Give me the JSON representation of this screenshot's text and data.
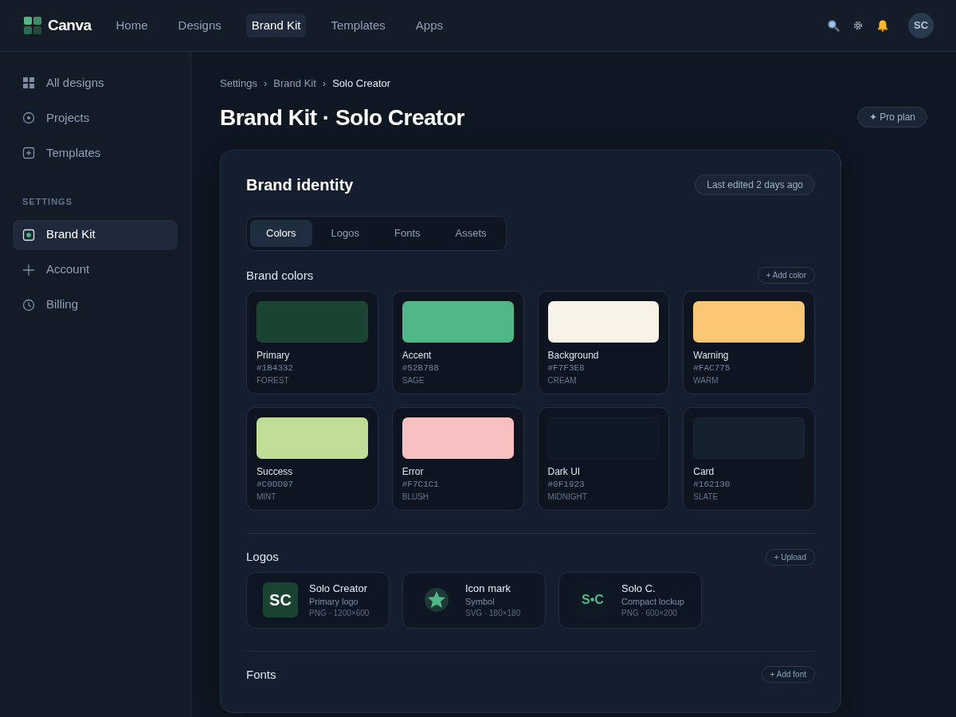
{
  "brand": "Canva",
  "nav": [
    {
      "label": "Home",
      "selected": false
    },
    {
      "label": "Designs",
      "selected": false
    },
    {
      "label": "Brand Kit",
      "selected": true
    },
    {
      "label": "Templates",
      "selected": false
    },
    {
      "label": "Apps",
      "selected": false
    }
  ],
  "avatar": "SC",
  "sidebar": {
    "items": [
      {
        "label": "All designs",
        "kind": "grid",
        "selected": false
      },
      {
        "label": "Projects",
        "kind": "target",
        "selected": false
      },
      {
        "label": "Templates",
        "kind": "add",
        "selected": false
      }
    ],
    "section": "SETTINGS",
    "settings_items": [
      {
        "label": "Brand Kit",
        "kind": "brand",
        "selected": true
      },
      {
        "label": "Account",
        "kind": "plus",
        "selected": false
      },
      {
        "label": "Billing",
        "kind": "clock",
        "selected": false
      }
    ]
  },
  "breadcrumb": {
    "items": [
      "Settings",
      "Brand Kit",
      "Solo Creator"
    ],
    "separators": [
      "›",
      "›"
    ]
  },
  "title": "Brand Kit · Solo Creator",
  "plan_badge": "✦ Pro plan",
  "card": {
    "title": "Brand identity",
    "edited": "Last edited 2 days ago",
    "tabs": [
      {
        "label": "Colors",
        "selected": true
      },
      {
        "label": "Logos",
        "selected": false
      },
      {
        "label": "Fonts",
        "selected": false
      },
      {
        "label": "Assets",
        "selected": false
      }
    ],
    "colors_heading": "Brand colors",
    "add_color": "+ Add color",
    "colors": [
      {
        "name": "Primary",
        "hex": "#1B4332",
        "tag": "FOREST",
        "color": "#1b4332"
      },
      {
        "name": "Accent",
        "hex": "#52B788",
        "tag": "SAGE",
        "color": "#52b788"
      },
      {
        "name": "Background",
        "hex": "#F7F3E8",
        "tag": "CREAM",
        "color": "#f7f3e8"
      },
      {
        "name": "Warning",
        "hex": "#FAC775",
        "tag": "WARM",
        "color": "#fac775"
      },
      {
        "name": "Success",
        "hex": "#C0DD97",
        "tag": "MINT",
        "color": "#c0dd97"
      },
      {
        "name": "Error",
        "hex": "#F7C1C1",
        "tag": "BLUSH",
        "color": "#f7c1c1"
      },
      {
        "name": "Dark UI",
        "hex": "#0F1923",
        "tag": "MIDNIGHT",
        "color": "#0f1923"
      },
      {
        "name": "Card",
        "hex": "#162130",
        "tag": "SLATE",
        "color": "#162130"
      }
    ],
    "logos_heading": "Logos",
    "upload": "+ Upload",
    "logos": [
      {
        "kind": "monogram",
        "mark": "SC",
        "name": "Solo Creator",
        "role": "Primary logo",
        "meta": "PNG · 1200×600"
      },
      {
        "kind": "star",
        "name": "Icon mark",
        "role": "Symbol",
        "meta": "SVG · 180×180"
      },
      {
        "kind": "lockup",
        "mark": "S•C",
        "name": "Solo C.",
        "role": "Compact lockup",
        "meta": "PNG · 600×200"
      }
    ],
    "fonts_heading": "Fonts",
    "add_font": "+ Add font"
  }
}
